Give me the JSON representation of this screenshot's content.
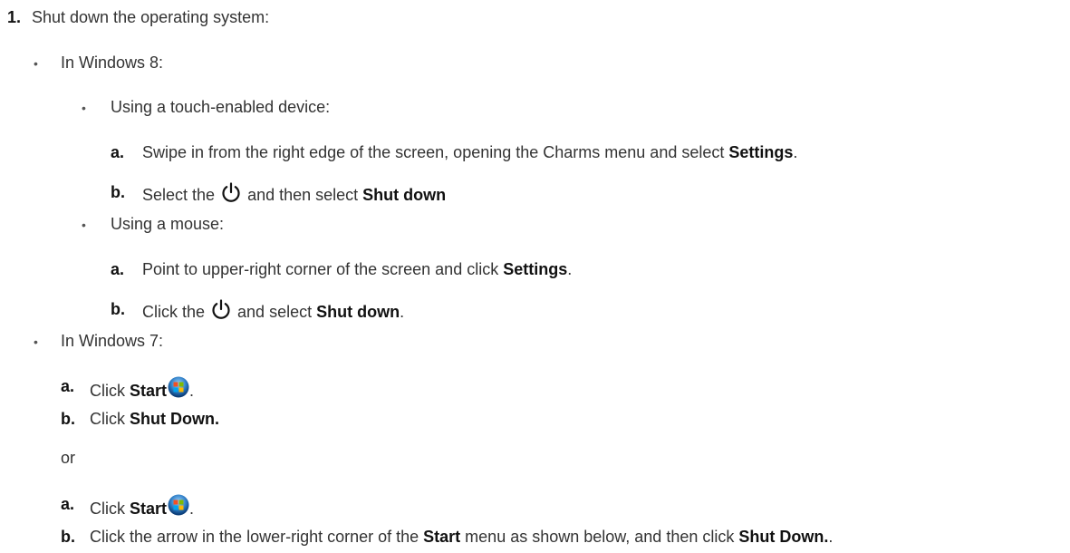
{
  "step": {
    "number": "1.",
    "title": "Shut down the operating system:"
  },
  "win8": {
    "heading": "In Windows 8:",
    "touch": {
      "heading": "Using a touch-enabled device:",
      "a": {
        "marker": "a.",
        "pre": "Swipe in from the right edge of the screen, opening the Charms menu and select ",
        "bold": "Settings",
        "post": "."
      },
      "b": {
        "marker": "b.",
        "pre": "Select the",
        "mid": "and then select ",
        "bold": "Shut down"
      }
    },
    "mouse": {
      "heading": "Using a mouse:",
      "a": {
        "marker": "a.",
        "pre": "Point to upper-right corner of the screen and click ",
        "bold": "Settings",
        "post": "."
      },
      "b": {
        "marker": "b.",
        "pre": "Click the",
        "mid": "and select ",
        "bold": "Shut down",
        "post": "."
      }
    }
  },
  "win7": {
    "heading": "In Windows 7:",
    "first": {
      "a": {
        "marker": "a.",
        "pre": "Click ",
        "bold": "Start",
        "post": "."
      },
      "b": {
        "marker": "b.",
        "pre": "Click ",
        "bold": "Shut Down."
      }
    },
    "or": "or",
    "second": {
      "a": {
        "marker": "a.",
        "pre": "Click ",
        "bold": "Start",
        "post": "."
      },
      "b": {
        "marker": "b.",
        "pre": "Click the arrow in the lower-right corner of the ",
        "bold1": "Start",
        "mid": " menu as shown below, and then click ",
        "bold2": "Shut Down.",
        "post": "."
      }
    }
  },
  "bullet_char": "•",
  "icons": {
    "power": "power-icon",
    "start_orb": "windows-start-orb-icon"
  }
}
